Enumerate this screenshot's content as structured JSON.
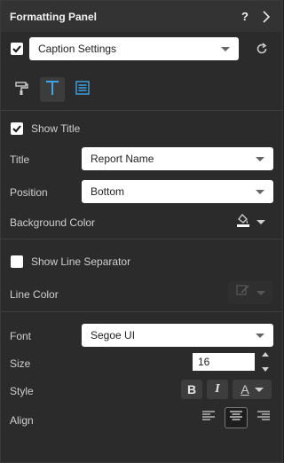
{
  "header": {
    "title": "Formatting Panel",
    "help_label": "?",
    "help_icon": "help-icon",
    "collapse_icon": "chevron-right-icon"
  },
  "caption": {
    "enabled": true,
    "selected": "Caption Settings",
    "reset_icon": "reset-icon"
  },
  "tabs": [
    {
      "icon": "paint-roller-icon",
      "active": false
    },
    {
      "icon": "text-icon",
      "active": true
    },
    {
      "icon": "list-icon",
      "active": false
    }
  ],
  "show_title": {
    "label": "Show Title",
    "checked": true
  },
  "title_field": {
    "label": "Title",
    "value": "Report Name"
  },
  "position_field": {
    "label": "Position",
    "value": "Bottom"
  },
  "background_color": {
    "label": "Background Color",
    "icon": "fill-color-icon"
  },
  "show_line_separator": {
    "label": "Show Line Separator",
    "checked": false
  },
  "line_color": {
    "label": "Line Color",
    "icon": "line-color-icon",
    "enabled": false
  },
  "font_field": {
    "label": "Font",
    "value": "Segoe UI"
  },
  "size_field": {
    "label": "Size",
    "value": "16"
  },
  "style_field": {
    "label": "Style",
    "bold_label": "B",
    "italic_label": "I",
    "color_label": "A"
  },
  "align_field": {
    "label": "Align",
    "options": [
      "left",
      "center",
      "right"
    ],
    "selected": "center"
  },
  "colors": {
    "accent": "#3ea6e6",
    "panel_bg": "#2b2b2b",
    "header_bg": "#333333"
  }
}
